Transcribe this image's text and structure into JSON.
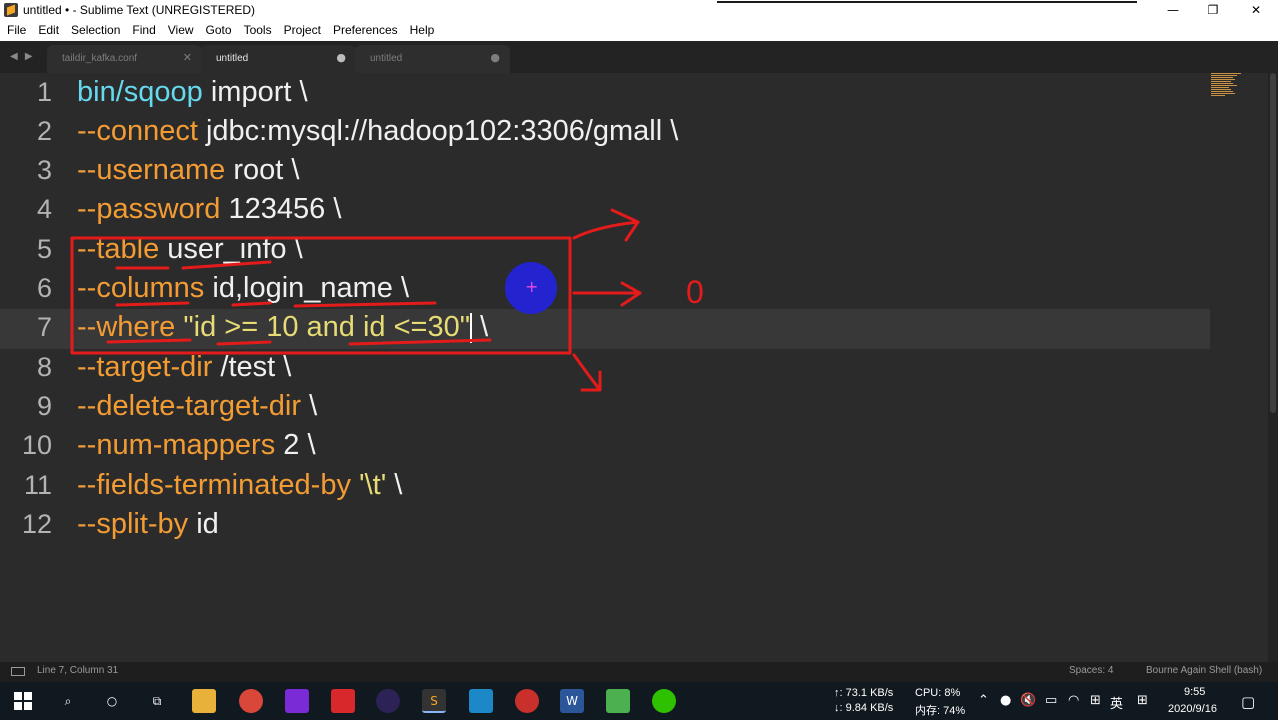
{
  "window": {
    "title": "untitled • - Sublime Text (UNREGISTERED)",
    "controls": {
      "minimize": "—",
      "restore": "❐",
      "close": "✕"
    }
  },
  "menu": [
    "File",
    "Edit",
    "Selection",
    "Find",
    "View",
    "Goto",
    "Tools",
    "Project",
    "Preferences",
    "Help"
  ],
  "tabs": [
    {
      "label": "taildir_kafka.conf",
      "close": "✕"
    },
    {
      "label": "untitled",
      "close": "●"
    },
    {
      "label": "untitled",
      "close": "●"
    }
  ],
  "tab_nav": "◀ ▶",
  "editor": {
    "current_line": 7,
    "lines": [
      {
        "n": "1",
        "a": "bin/sqoop",
        "b": " import \\"
      },
      {
        "n": "2",
        "a": "--connect",
        "b": " jdbc:mysql://hadoop102:3306/gmall \\"
      },
      {
        "n": "3",
        "a": "--username",
        "b": " root \\"
      },
      {
        "n": "4",
        "a": "--password",
        "b": " 123456 \\"
      },
      {
        "n": "5",
        "a": "--table",
        "b": " user_info \\"
      },
      {
        "n": "6",
        "a": "--columns",
        "b": " id,login_name \\"
      },
      {
        "n": "7",
        "a": "--where",
        "s": "\"id >= 10 and id <=30\"",
        "b": " \\"
      },
      {
        "n": "8",
        "a": "--target-dir",
        "b": " /test \\"
      },
      {
        "n": "9",
        "a": "--delete-target-dir",
        "b": " \\"
      },
      {
        "n": "10",
        "a": "--num-mappers",
        "b": " 2 \\"
      },
      {
        "n": "11",
        "a": "--fields-terminated-by",
        "s": "'\\t'",
        "b": " \\"
      },
      {
        "n": "12",
        "a": "--split-by",
        "b": " id"
      }
    ]
  },
  "annotation": {
    "note": "0",
    "color": "#e41b1b"
  },
  "status": {
    "position": "Line 7, Column 31",
    "spaces": "Spaces: 4",
    "syntax": "Bourne Again Shell (bash)"
  },
  "taskbar": {
    "net_up": "↑: 73.1 KB/s",
    "net_down": "↓: 9.84 KB/s",
    "cpu": "CPU: 8%",
    "mem": "内存: 74%",
    "ime": "英",
    "time": "9:55",
    "date": "2020/9/16",
    "apps": [
      "windows-icon",
      "search-icon",
      "cortana-icon",
      "task-view-icon",
      "file-explorer-icon",
      "chrome-icon",
      "intellij-icon",
      "youdao-icon",
      "eclipse-icon",
      "sublime-icon",
      "vmware-icon",
      "xshell-icon",
      "word-icon",
      "screen-recorder-icon",
      "wechat-icon"
    ]
  }
}
